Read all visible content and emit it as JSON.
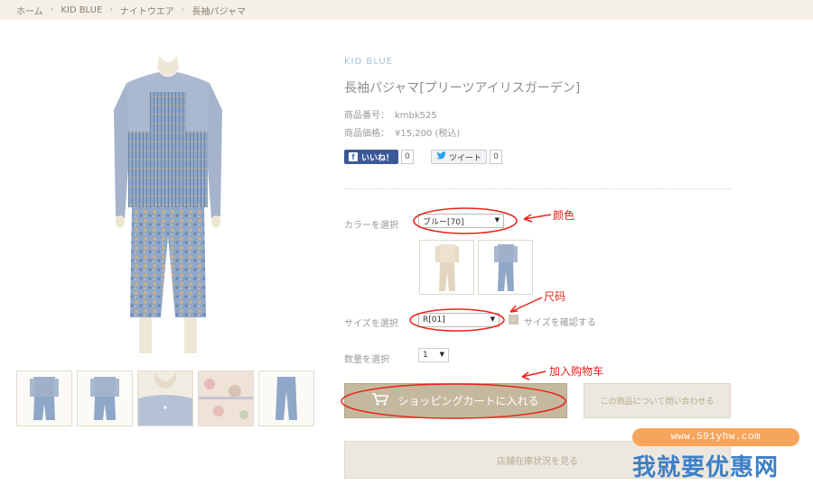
{
  "breadcrumb": {
    "items": [
      "ホーム",
      "KID BLUE",
      "ナイトウエア",
      "長袖パジャマ"
    ],
    "separator": "›"
  },
  "product": {
    "brand": "KID BLUE",
    "title": "長袖パジャマ[プリーツアイリスガーデン]",
    "code_label": "商品番号：",
    "code": "kmbk525",
    "price_label": "商品価格：",
    "price": "¥15,200 (税込)"
  },
  "social": {
    "facebook_label": "いいね！",
    "facebook_icon": "f",
    "facebook_count": "0",
    "twitter_label": "ツイート",
    "twitter_icon": "twitter-bird",
    "twitter_count": "0"
  },
  "options": {
    "color_label": "カラーを選択",
    "color_value": "ブルー[70]",
    "size_label": "サイズを選択",
    "size_value": "R[01]",
    "size_link": "サイズを確認する",
    "qty_label": "数量を選択",
    "qty_value": "1"
  },
  "buttons": {
    "cart": "ショッピングカートに入れる",
    "inquiry": "この商品について問い合わせる",
    "stock": "店舗在庫状況を見る"
  },
  "annotations": {
    "color": "颜色",
    "size": "尺码",
    "cart": "加入购物车"
  },
  "watermark": {
    "url": "www.591yhw.com",
    "text": "我就要优惠网"
  },
  "colors": {
    "accent_button": "#c4b99e",
    "brand_blue": "#9fc3d8",
    "annotation_red": "#e8231a",
    "facebook": "#3b5998"
  }
}
